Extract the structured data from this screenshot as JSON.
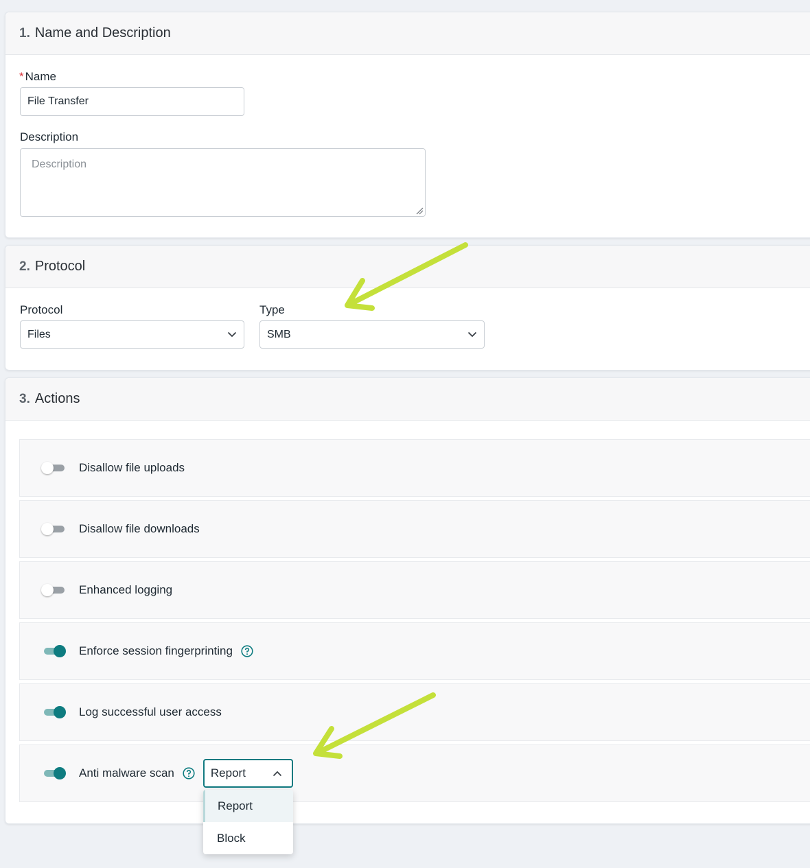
{
  "sections": {
    "s1": {
      "number": "1.",
      "title": "Name and Description"
    },
    "s2": {
      "number": "2.",
      "title": "Protocol"
    },
    "s3": {
      "number": "3.",
      "title": "Actions"
    }
  },
  "name_field": {
    "required_mark": "*",
    "label": "Name",
    "value": "File Transfer"
  },
  "description_field": {
    "label": "Description",
    "placeholder": "Description"
  },
  "protocol_field": {
    "label": "Protocol",
    "value": "Files"
  },
  "type_field": {
    "label": "Type",
    "value": "SMB"
  },
  "actions": [
    {
      "label": "Disallow file uploads",
      "enabled": false
    },
    {
      "label": "Disallow file downloads",
      "enabled": false
    },
    {
      "label": "Enhanced logging",
      "enabled": false
    },
    {
      "label": "Enforce session fingerprinting",
      "enabled": true,
      "help_icon": "help-circle-icon"
    },
    {
      "label": "Log successful user access",
      "enabled": true
    },
    {
      "label": "Anti malware scan",
      "enabled": true,
      "help_icon": "help-circle-icon",
      "mode_value": "Report"
    }
  ],
  "malware_mode_dropdown": {
    "options": [
      "Report",
      "Block"
    ],
    "selected": "Report"
  },
  "colors": {
    "accent": "#0e7c80",
    "annotation_arrow": "#c4e03a",
    "required": "#d9363e"
  }
}
